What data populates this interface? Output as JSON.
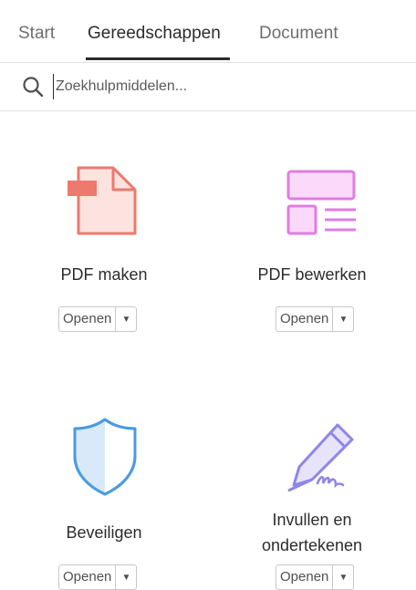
{
  "tabs": {
    "start": "Start",
    "tools": "Gereedschappen",
    "document": "Document"
  },
  "search": {
    "placeholder": "Zoekhulpmiddelen..."
  },
  "tools": [
    {
      "label": "PDF maken",
      "button": "Openen",
      "icon": "create-pdf-icon",
      "color": "#ec7a6e"
    },
    {
      "label": "PDF bewerken",
      "button": "Openen",
      "icon": "edit-pdf-icon",
      "color": "#e27ce3"
    },
    {
      "label": "Beveiligen",
      "button": "Openen",
      "icon": "shield-icon",
      "color": "#4b9be0"
    },
    {
      "label_line1": "Invullen en",
      "label_line2": "ondertekenen",
      "button": "Openen",
      "icon": "fill-sign-icon",
      "color": "#8e86e8"
    }
  ],
  "arrow": "▼"
}
